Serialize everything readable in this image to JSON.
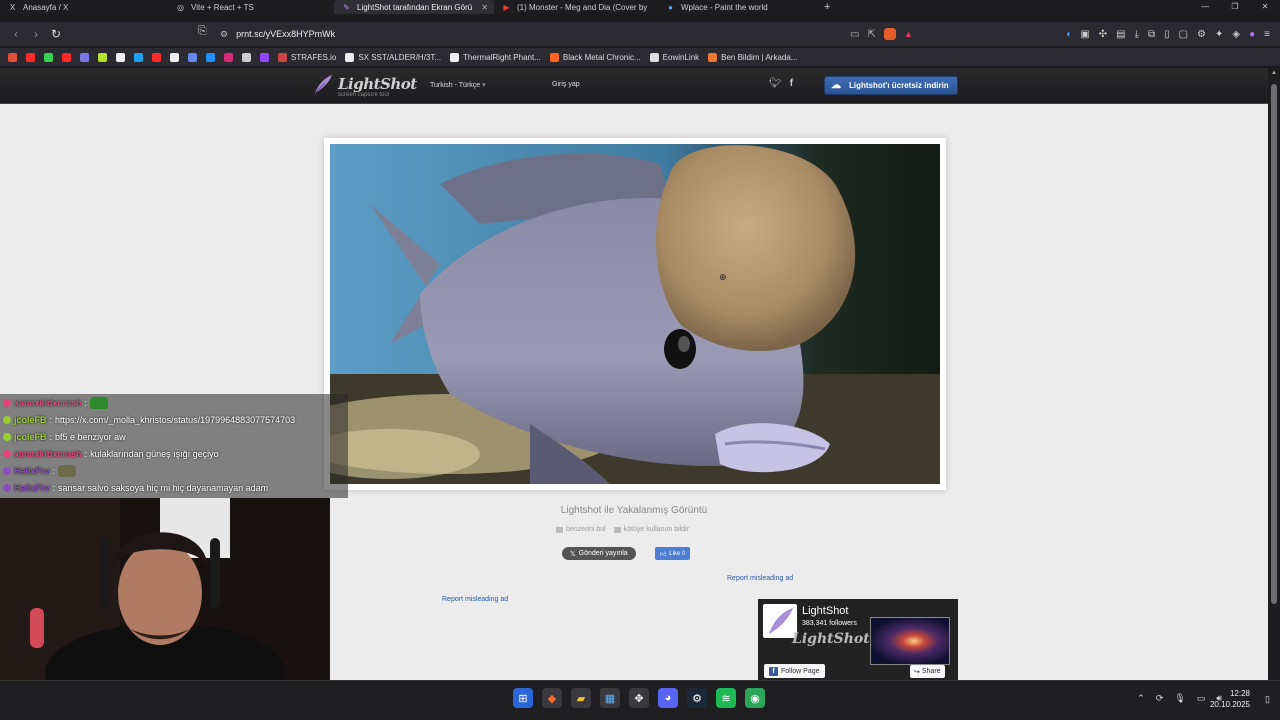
{
  "window": {
    "tabs": [
      {
        "label": "Anasayfa / X",
        "icon": "X",
        "active": false
      },
      {
        "label": "Vite + React + TS",
        "icon": "◎",
        "active": false
      },
      {
        "label": "LightShot tarafından Ekran Görü",
        "icon": "✎",
        "active": true
      },
      {
        "label": "(1) Monster - Meg and Dia (Cover by",
        "icon": "▶",
        "active": false
      },
      {
        "label": "Wplace - Paint the world",
        "icon": "●",
        "active": false
      }
    ],
    "new_tab_label": "+",
    "controls": [
      "—",
      "❐",
      "✕"
    ]
  },
  "navbar": {
    "url": "prnt.sc/yVExx8HYPmWk"
  },
  "bookmarks": [
    {
      "label": "",
      "color": "#e0503a"
    },
    {
      "label": "",
      "color": "#ff2a2a"
    },
    {
      "label": "",
      "color": "#39d353"
    },
    {
      "label": "",
      "color": "#ff2a2a"
    },
    {
      "label": "",
      "color": "#7a7ae6"
    },
    {
      "label": "",
      "color": "#b6e22d"
    },
    {
      "label": "",
      "color": "#eeeeee"
    },
    {
      "label": "",
      "color": "#1da1f2"
    },
    {
      "label": "",
      "color": "#ff2a2a"
    },
    {
      "label": "",
      "color": "#eeeeee"
    },
    {
      "label": "",
      "color": "#6688ee"
    },
    {
      "label": "",
      "color": "#1e90ff"
    },
    {
      "label": "",
      "color": "#d62976"
    },
    {
      "label": "",
      "color": "#cccccc"
    },
    {
      "label": "",
      "color": "#9146ff"
    },
    {
      "label": "STRAFES.io",
      "color": "#cc4444"
    },
    {
      "label": "SX SST/ALDER/H/3T...",
      "color": "#eeeeee"
    },
    {
      "label": "ThermalRight Phant...",
      "color": "#eeeeee"
    },
    {
      "label": "Black Metal Chronic...",
      "color": "#ff6622"
    },
    {
      "label": "EowinLink",
      "color": "#dddddd"
    },
    {
      "label": "Ben Bildim | Arkada...",
      "color": "#ee7733"
    }
  ],
  "site": {
    "logo_text": "LightShot",
    "logo_sub": "screen capture tool",
    "language": "Turkish - Türkçe",
    "login": "Giriş yap",
    "download_button": "Lightshot'ı ücretsiz indirin"
  },
  "screenshot": {
    "caption": "Lightshot ile Yakalanmış Görüntü",
    "find_similar": "benzerini bul",
    "report_abuse": "kötüye kullanım bildir",
    "tweet": "Gönderi yayınla",
    "like": "Like 0",
    "report_ad_1": "Report misleading ad",
    "report_ad_2": "Report misleading ad"
  },
  "facebook": {
    "page_name": "LightShot",
    "followers": "383,341 followers",
    "brand": "LightShot",
    "follow": "Follow Page",
    "share": "Share"
  },
  "chat": [
    {
      "user": "xanaxkidxcrash",
      "sep": " :",
      "message": "",
      "user_color": "#e0457b",
      "emote": "#2c8a2c"
    },
    {
      "user": "jcoleFB",
      "sep": " :",
      "message": "https://x.com/_molla_khristos/status/1979964883077574703",
      "user_color": "#9acd32"
    },
    {
      "user": "jcoleFB",
      "sep": " :",
      "message": "bf5 e benziyor aw",
      "user_color": "#9acd32"
    },
    {
      "user": "xanaxkidxcrash",
      "sep": " :",
      "message": "kulaklarından güneş ışığı geçiyo",
      "user_color": "#e0457b"
    },
    {
      "user": "HelixFrv",
      "sep": " :",
      "message": "",
      "user_color": "#8a4fbf",
      "emote": "#6b6b4a"
    },
    {
      "user": "HelixFrv",
      "sep": " :",
      "message": "sansar salvo saksoya hiç mi hiç dayanamayan adam",
      "user_color": "#8a4fbf"
    }
  ],
  "taskbar": {
    "time": "12:28",
    "date": "20.10.2025"
  }
}
